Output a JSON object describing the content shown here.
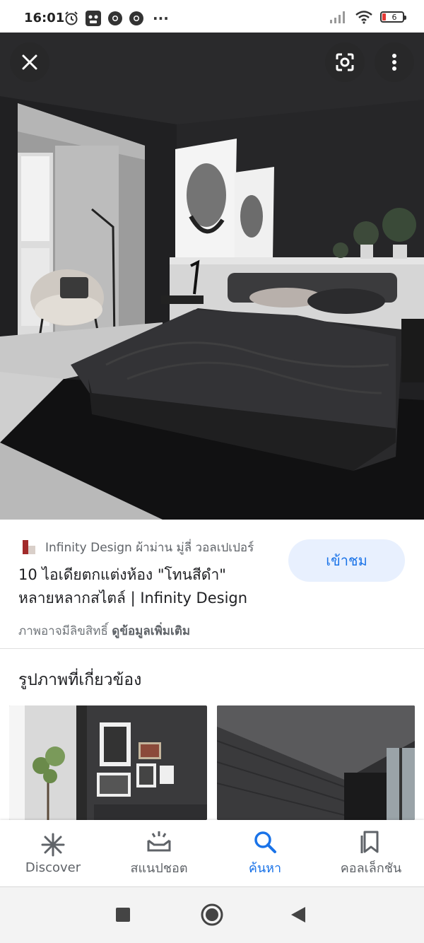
{
  "status_bar": {
    "time": "16:01",
    "dots": "···",
    "battery": "6",
    "icons": [
      "alarm-icon",
      "tiger-app-icon",
      "chrome-icon",
      "chrome-icon",
      "signal-icon",
      "wifi-icon",
      "battery-icon"
    ]
  },
  "viewer": {
    "close_icon": "close-icon",
    "lens_icon": "lens-icon",
    "more_icon": "more-vertical-icon"
  },
  "result": {
    "source": "Infinity Design ผ้าม่าน มู่ลี่ วอลเปเปอร์",
    "title_line1": "10 ไอเดียตกแต่งห้อง \"โทนสีดำ\"",
    "title_line2": "หลายหลากสไตล์ | Infinity Design",
    "rights_text": "ภาพอาจมีลิขสิทธิ์",
    "more_info": "ดูข้อมูลเพิ่มเติม",
    "visit_label": "เข้าชม"
  },
  "related": {
    "heading": "รูปภาพที่เกี่ยวข้อง"
  },
  "bottom_nav": {
    "items": [
      {
        "label": "Discover",
        "icon": "discover-asterisk-icon"
      },
      {
        "label": "สแนปชอต",
        "icon": "snapshot-icon"
      },
      {
        "label": "ค้นหา",
        "icon": "search-icon"
      },
      {
        "label": "คอลเล็กชัน",
        "icon": "collections-icon"
      }
    ],
    "active_index": 2
  },
  "system_nav": {
    "icons": [
      "recents-square-icon",
      "home-circle-icon",
      "back-triangle-icon"
    ]
  },
  "colors": {
    "accent": "#1a73e8",
    "visit_bg": "#e8f0fe",
    "text_primary": "#202124",
    "text_secondary": "#5f6368"
  }
}
